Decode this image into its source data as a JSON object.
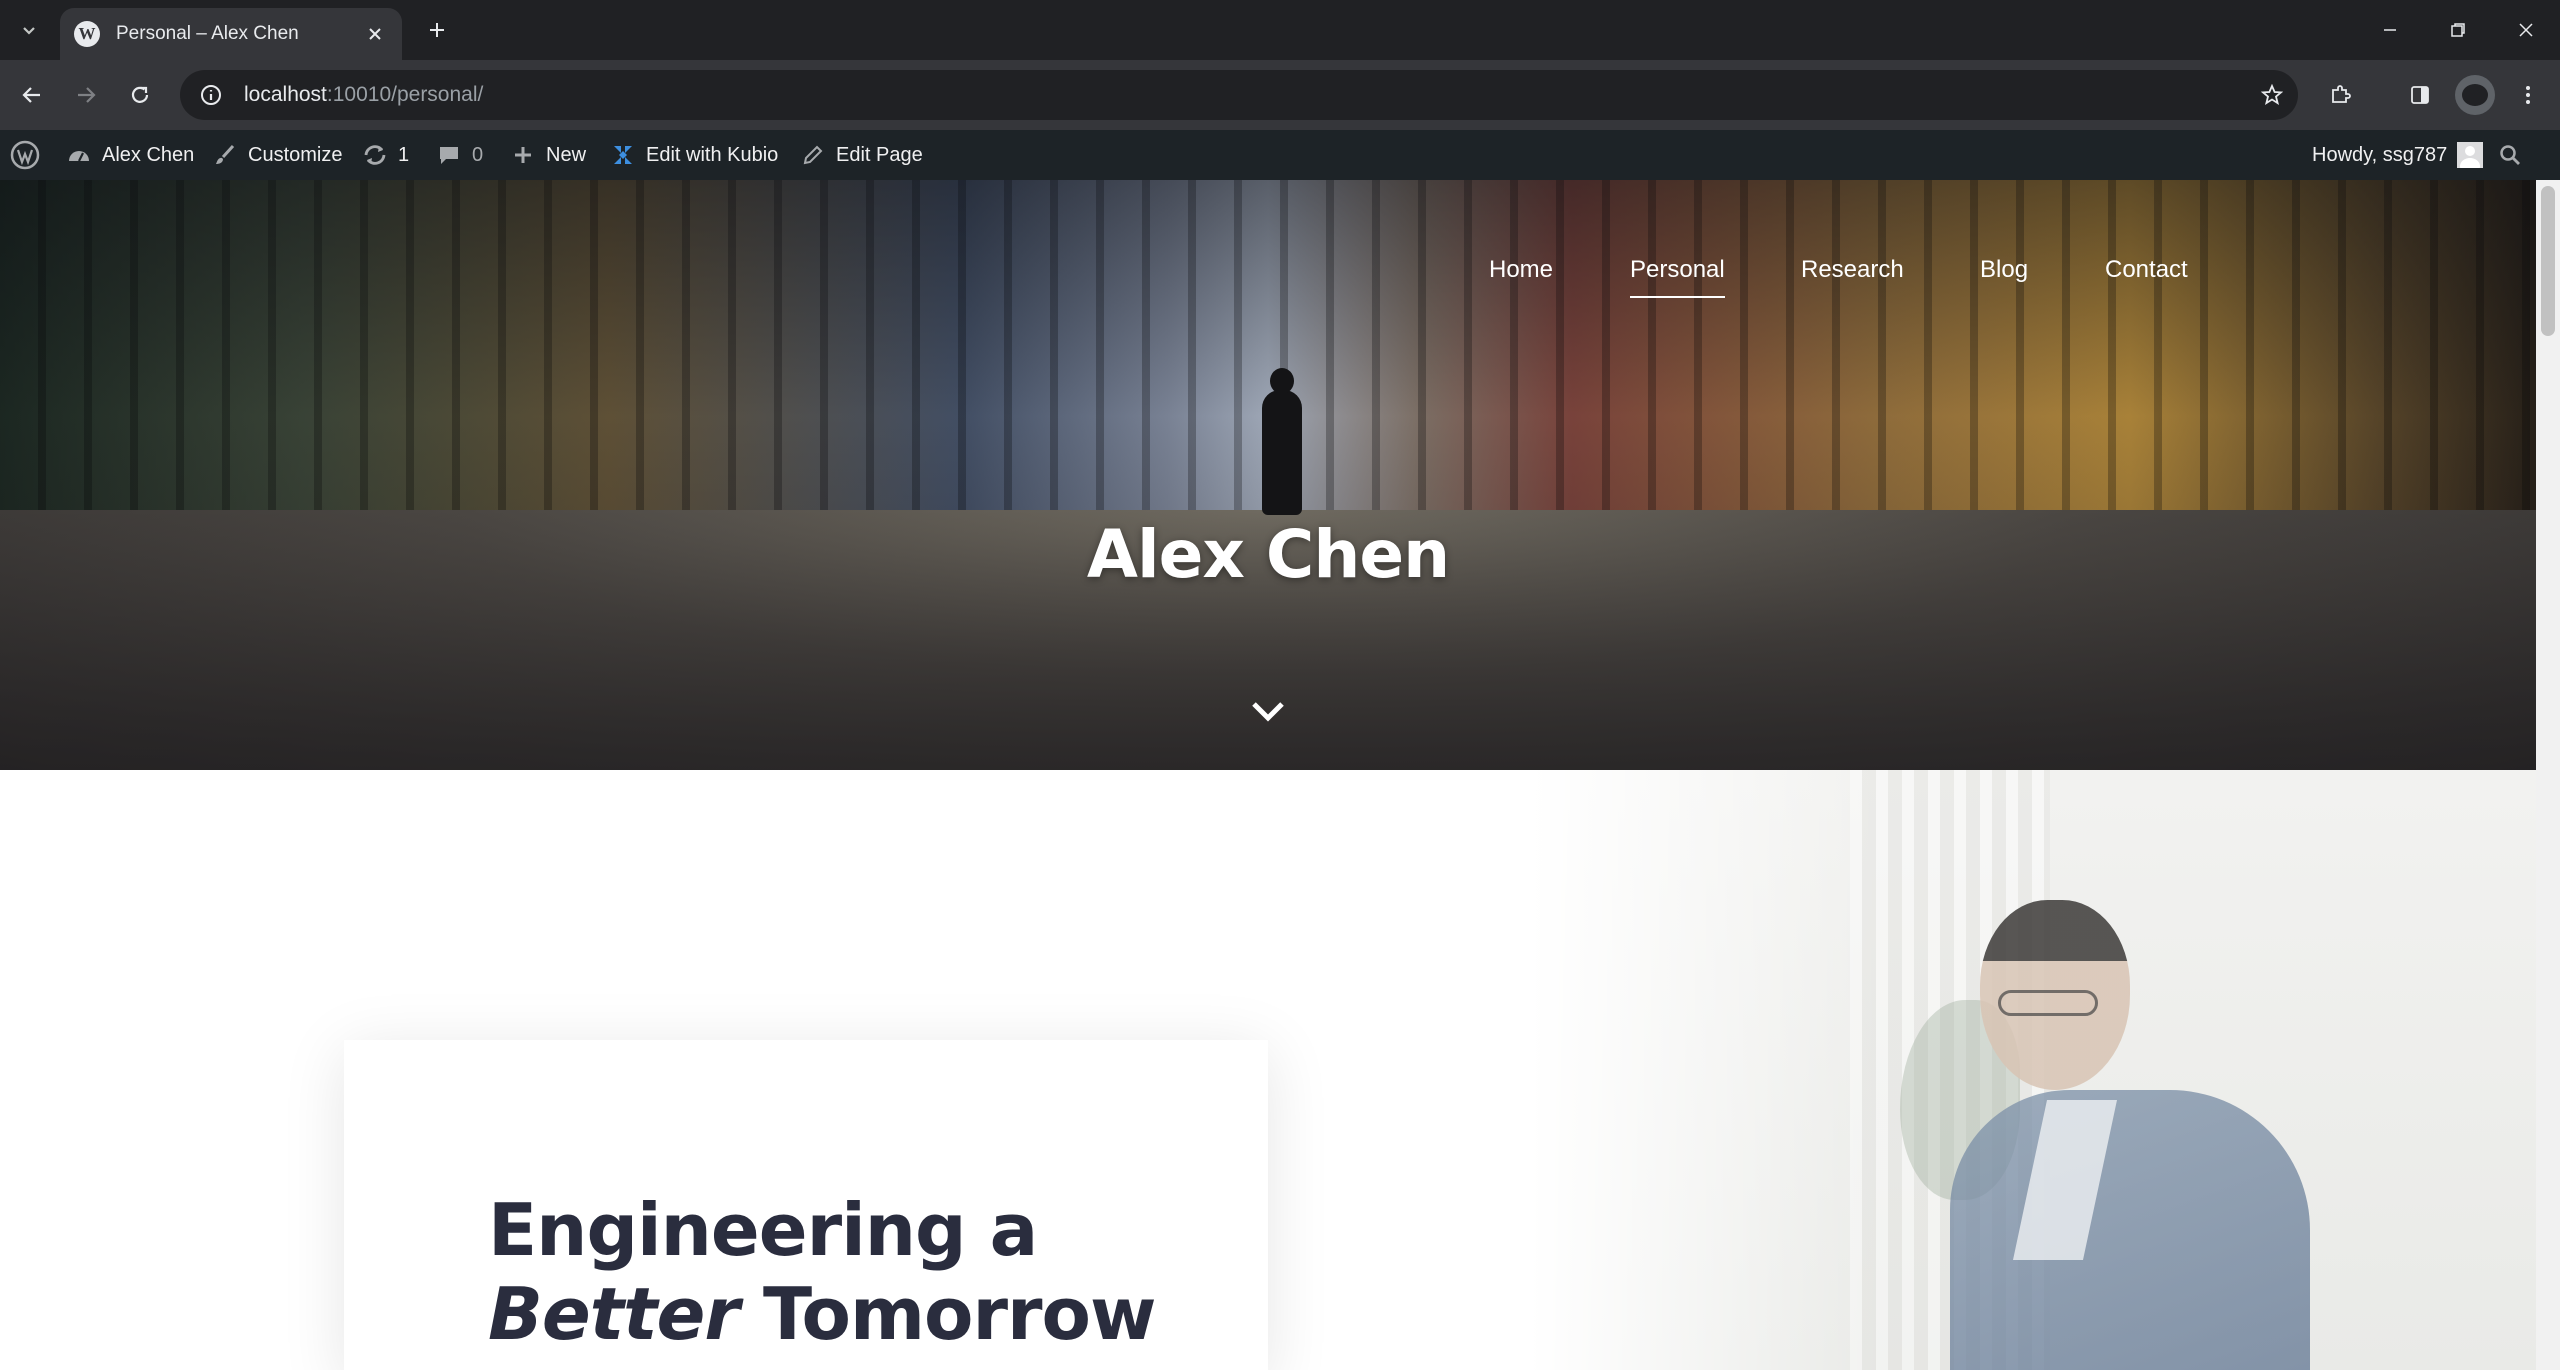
{
  "browser": {
    "tab": {
      "title": "Personal – Alex Chen",
      "favicon": "W"
    },
    "url": {
      "host": "localhost",
      "rest": ":10010/personal/"
    }
  },
  "adminbar": {
    "site_name": "Alex Chen",
    "customize": "Customize",
    "updates_count": "1",
    "comments_count": "0",
    "new": "New",
    "edit_kubio": "Edit with Kubio",
    "edit_page": "Edit Page",
    "howdy": "Howdy, ssg787"
  },
  "hero": {
    "nav": [
      "Home",
      "Personal",
      "Research",
      "Blog",
      "Contact"
    ],
    "active_nav": "Personal",
    "title": "Alex Chen"
  },
  "card": {
    "line1": "Engineering a",
    "line2_italic": "Better",
    "line2_rest": " Tomorrow"
  },
  "colors": {
    "adminbar_bg": "#1d2327",
    "heading_text": "#2a2d3e",
    "browser_bg": "#202124"
  }
}
